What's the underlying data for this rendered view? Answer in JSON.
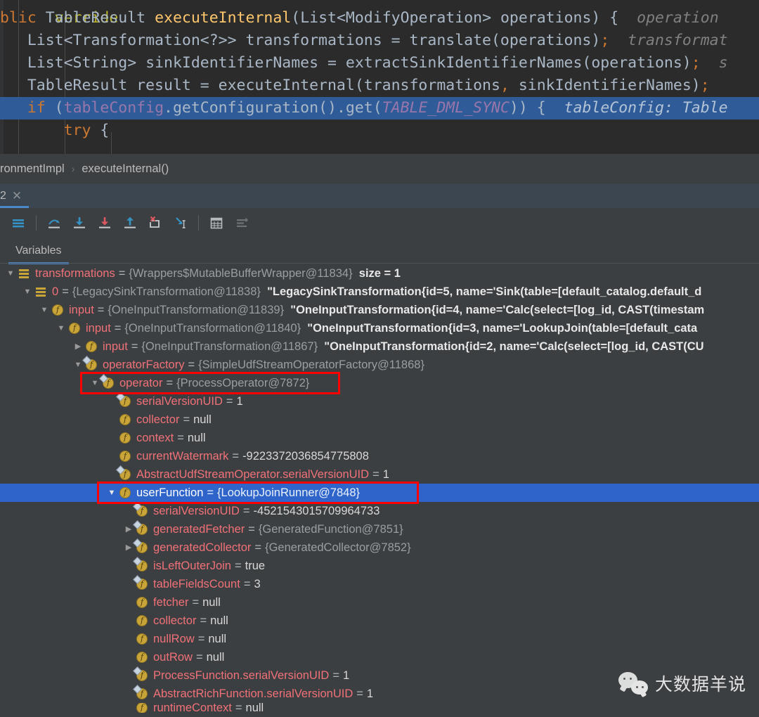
{
  "editor": {
    "annotation_partial": "verride",
    "lines": [
      {
        "id": "signature",
        "highlighted": false,
        "segments": [
          {
            "t": "blic ",
            "c": "kw"
          },
          {
            "t": "TableResult ",
            "c": "typ"
          },
          {
            "t": "executeInternal",
            "c": "meth"
          },
          {
            "t": "(List<ModifyOperation> operations) {",
            "c": "plain"
          },
          {
            "t": "  operation",
            "c": "hint"
          }
        ]
      },
      {
        "id": "translate",
        "highlighted": false,
        "segments": [
          {
            "t": "   List<Transformation<?>> transformations = translate(operations)",
            "c": "plain"
          },
          {
            "t": ";",
            "c": "punc"
          },
          {
            "t": "  transformat",
            "c": "hint"
          }
        ]
      },
      {
        "id": "extract-sink-names",
        "highlighted": false,
        "segments": [
          {
            "t": "   List<String> sinkIdentifierNames = extractSinkIdentifierNames(operations)",
            "c": "plain"
          },
          {
            "t": ";",
            "c": "punc"
          },
          {
            "t": "  s",
            "c": "hint"
          }
        ]
      },
      {
        "id": "execute-internal-call",
        "highlighted": false,
        "segments": [
          {
            "t": "   TableResult result = executeInternal(transformations",
            "c": "plain"
          },
          {
            "t": ",",
            "c": "punc"
          },
          {
            "t": " sinkIdentifierNames)",
            "c": "plain"
          },
          {
            "t": ";",
            "c": "punc"
          }
        ]
      },
      {
        "id": "if-table-dml-sync",
        "highlighted": true,
        "segments": [
          {
            "t": "   ",
            "c": "plain"
          },
          {
            "t": "if",
            "c": "kw"
          },
          {
            "t": " (",
            "c": "plain"
          },
          {
            "t": "tableConfig",
            "c": "fld"
          },
          {
            "t": ".getConfiguration().get(",
            "c": "plain"
          },
          {
            "t": "TABLE_DML_SYNC",
            "c": "const"
          },
          {
            "t": ")) {",
            "c": "plain"
          },
          {
            "t": "  tableConfig: Table",
            "c": "hint-on-hl"
          }
        ]
      },
      {
        "id": "try-block",
        "highlighted": false,
        "segments": [
          {
            "t": "       ",
            "c": "plain"
          },
          {
            "t": "try",
            "c": "kw"
          },
          {
            "t": " {",
            "c": "plain"
          }
        ]
      }
    ]
  },
  "breadcrumb": {
    "crumbs": [
      "ronmentImpl",
      "executeInternal()"
    ],
    "separator": "›"
  },
  "debug_tabs": {
    "active_label": "2",
    "close_glyph": "✕"
  },
  "debug_toolbar": {
    "buttons": [
      {
        "name": "show-execution-point-icon",
        "label": "Show Execution Point"
      },
      {
        "name": "step-over-icon",
        "label": "Step Over"
      },
      {
        "name": "step-into-icon",
        "label": "Step Into"
      },
      {
        "name": "force-step-into-icon",
        "label": "Force Step Into"
      },
      {
        "name": "step-out-icon",
        "label": "Step Out"
      },
      {
        "name": "drop-frame-icon",
        "label": "Drop Frame"
      },
      {
        "name": "run-to-cursor-icon",
        "label": "Run to Cursor"
      },
      {
        "name": "evaluate-expression-icon",
        "label": "Evaluate Expression"
      },
      {
        "name": "settings-icon",
        "label": "Layout Settings"
      }
    ]
  },
  "variables_panel": {
    "tab_label": "Variables",
    "rows": [
      {
        "indent": 0,
        "arrow": "down",
        "icon": "list",
        "name": "transformations",
        "ref": "{Wrappers$MutableBufferWrapper@11834}",
        "extra": "size = 1",
        "extra_kind": "size",
        "selected": false,
        "boxed": false
      },
      {
        "indent": 1,
        "arrow": "down",
        "icon": "list",
        "name": "0",
        "ref": "{LegacySinkTransformation@11838}",
        "extra": "\"LegacySinkTransformation{id=5, name='Sink(table=[default_catalog.default_d",
        "extra_kind": "string",
        "selected": false,
        "boxed": false
      },
      {
        "indent": 2,
        "arrow": "down",
        "icon": "field",
        "name": "input",
        "ref": "{OneInputTransformation@11839}",
        "extra": "\"OneInputTransformation{id=4, name='Calc(select=[log_id, CAST(timestam",
        "extra_kind": "string",
        "selected": false,
        "boxed": false
      },
      {
        "indent": 3,
        "arrow": "down",
        "icon": "field",
        "name": "input",
        "ref": "{OneInputTransformation@11840}",
        "extra": "\"OneInputTransformation{id=3, name='LookupJoin(table=[default_cata",
        "extra_kind": "string",
        "selected": false,
        "boxed": false
      },
      {
        "indent": 4,
        "arrow": "right",
        "icon": "field",
        "name": "input",
        "ref": "{OneInputTransformation@11867}",
        "extra": "\"OneInputTransformation{id=2, name='Calc(select=[log_id, CAST(CU",
        "extra_kind": "string",
        "selected": false,
        "boxed": false
      },
      {
        "indent": 4,
        "arrow": "down",
        "icon": "field-static",
        "name": "operatorFactory",
        "ref": "{SimpleUdfStreamOperatorFactory@11868}",
        "extra": "",
        "extra_kind": "",
        "selected": false,
        "boxed": false
      },
      {
        "indent": 5,
        "arrow": "down",
        "icon": "field-static",
        "name": "operator",
        "ref": "{ProcessOperator@7872}",
        "extra": "",
        "extra_kind": "",
        "selected": false,
        "boxed": true
      },
      {
        "indent": 6,
        "arrow": "none",
        "icon": "field-static",
        "name": "serialVersionUID",
        "ref": "",
        "extra": "1",
        "extra_kind": "value",
        "selected": false,
        "boxed": false
      },
      {
        "indent": 6,
        "arrow": "none",
        "icon": "field",
        "name": "collector",
        "ref": "",
        "extra": "null",
        "extra_kind": "value",
        "selected": false,
        "boxed": false
      },
      {
        "indent": 6,
        "arrow": "none",
        "icon": "field",
        "name": "context",
        "ref": "",
        "extra": "null",
        "extra_kind": "value",
        "selected": false,
        "boxed": false
      },
      {
        "indent": 6,
        "arrow": "none",
        "icon": "field",
        "name": "currentWatermark",
        "ref": "",
        "extra": "-9223372036854775808",
        "extra_kind": "value",
        "selected": false,
        "boxed": false
      },
      {
        "indent": 6,
        "arrow": "none",
        "icon": "field-static",
        "name": "AbstractUdfStreamOperator.serialVersionUID",
        "ref": "",
        "extra": "1",
        "extra_kind": "value",
        "selected": false,
        "boxed": false
      },
      {
        "indent": 6,
        "arrow": "down",
        "icon": "field",
        "name": "userFunction",
        "ref": "{LookupJoinRunner@7848}",
        "extra": "",
        "extra_kind": "",
        "selected": true,
        "boxed": true
      },
      {
        "indent": 7,
        "arrow": "none",
        "icon": "field-static",
        "name": "serialVersionUID",
        "ref": "",
        "extra": "-4521543015709964733",
        "extra_kind": "value",
        "selected": false,
        "boxed": false
      },
      {
        "indent": 7,
        "arrow": "right",
        "icon": "field-static",
        "name": "generatedFetcher",
        "ref": "{GeneratedFunction@7851}",
        "extra": "",
        "extra_kind": "",
        "selected": false,
        "boxed": false
      },
      {
        "indent": 7,
        "arrow": "right",
        "icon": "field-static",
        "name": "generatedCollector",
        "ref": "{GeneratedCollector@7852}",
        "extra": "",
        "extra_kind": "",
        "selected": false,
        "boxed": false
      },
      {
        "indent": 7,
        "arrow": "none",
        "icon": "field-static",
        "name": "isLeftOuterJoin",
        "ref": "",
        "extra": "true",
        "extra_kind": "value",
        "selected": false,
        "boxed": false
      },
      {
        "indent": 7,
        "arrow": "none",
        "icon": "field-static",
        "name": "tableFieldsCount",
        "ref": "",
        "extra": "3",
        "extra_kind": "value",
        "selected": false,
        "boxed": false
      },
      {
        "indent": 7,
        "arrow": "none",
        "icon": "field",
        "name": "fetcher",
        "ref": "",
        "extra": "null",
        "extra_kind": "value",
        "selected": false,
        "boxed": false
      },
      {
        "indent": 7,
        "arrow": "none",
        "icon": "field",
        "name": "collector",
        "ref": "",
        "extra": "null",
        "extra_kind": "value",
        "selected": false,
        "boxed": false
      },
      {
        "indent": 7,
        "arrow": "none",
        "icon": "field",
        "name": "nullRow",
        "ref": "",
        "extra": "null",
        "extra_kind": "value",
        "selected": false,
        "boxed": false
      },
      {
        "indent": 7,
        "arrow": "none",
        "icon": "field",
        "name": "outRow",
        "ref": "",
        "extra": "null",
        "extra_kind": "value",
        "selected": false,
        "boxed": false
      },
      {
        "indent": 7,
        "arrow": "none",
        "icon": "field-static",
        "name": "ProcessFunction.serialVersionUID",
        "ref": "",
        "extra": "1",
        "extra_kind": "value",
        "selected": false,
        "boxed": false
      },
      {
        "indent": 7,
        "arrow": "none",
        "icon": "field-static",
        "name": "AbstractRichFunction.serialVersionUID",
        "ref": "",
        "extra": "1",
        "extra_kind": "value",
        "selected": false,
        "boxed": false
      },
      {
        "indent": 7,
        "arrow": "none",
        "icon": "field",
        "name": "runtimeContext",
        "ref": "",
        "extra": "null",
        "extra_kind": "value",
        "selected": false,
        "boxed": false,
        "clipped": true
      }
    ]
  },
  "watermark": {
    "text": "大数据羊说",
    "logo_name": "wechat-logo"
  },
  "colors": {
    "editor_bg": "#2b2b2b",
    "panel_bg": "#3c3f41",
    "selection_blue": "#2f65ca",
    "code_highlight_blue": "#2f5c98",
    "accent_blue": "#4a88c7",
    "annotation_red": "#ff0000",
    "field_name": "#f07178",
    "keyword_orange": "#cc7832",
    "method_yellow": "#ffc66d"
  }
}
